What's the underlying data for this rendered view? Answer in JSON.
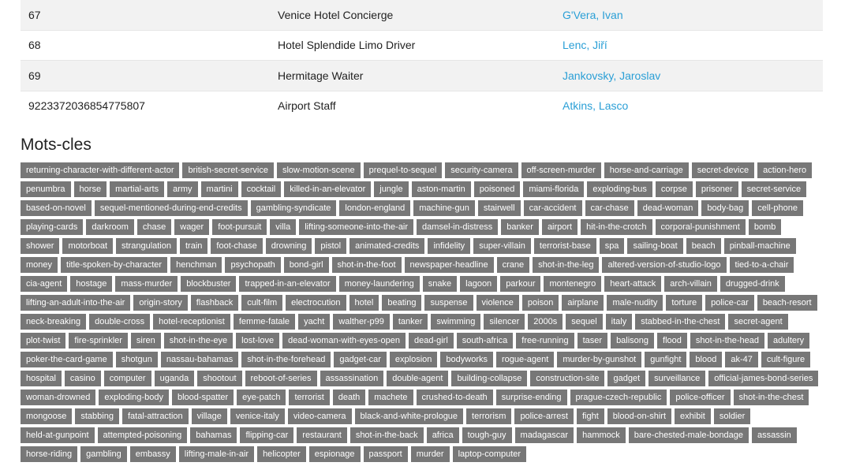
{
  "cast_rows": [
    {
      "id": "67",
      "role": "Venice Hotel Concierge",
      "actor": "G'Vera, Ivan"
    },
    {
      "id": "68",
      "role": "Hotel Splendide Limo Driver",
      "actor": "Lenc, Jiří"
    },
    {
      "id": "69",
      "role": "Hermitage Waiter",
      "actor": "Jankovsky, Jaroslav"
    },
    {
      "id": "9223372036854775807",
      "role": "Airport Staff",
      "actor": "Atkins, Lasco"
    }
  ],
  "keywords_section": {
    "title": "Mots-cles",
    "tags": [
      "returning-character-with-different-actor",
      "british-secret-service",
      "slow-motion-scene",
      "prequel-to-sequel",
      "security-camera",
      "off-screen-murder",
      "horse-and-carriage",
      "secret-device",
      "action-hero",
      "penumbra",
      "horse",
      "martial-arts",
      "army",
      "martini",
      "cocktail",
      "killed-in-an-elevator",
      "jungle",
      "aston-martin",
      "poisoned",
      "miami-florida",
      "exploding-bus",
      "corpse",
      "prisoner",
      "secret-service",
      "based-on-novel",
      "sequel-mentioned-during-end-credits",
      "gambling-syndicate",
      "london-england",
      "machine-gun",
      "stairwell",
      "car-accident",
      "car-chase",
      "dead-woman",
      "body-bag",
      "cell-phone",
      "playing-cards",
      "darkroom",
      "chase",
      "wager",
      "foot-pursuit",
      "villa",
      "lifting-someone-into-the-air",
      "damsel-in-distress",
      "banker",
      "airport",
      "hit-in-the-crotch",
      "corporal-punishment",
      "bomb",
      "shower",
      "motorboat",
      "strangulation",
      "train",
      "foot-chase",
      "drowning",
      "pistol",
      "animated-credits",
      "infidelity",
      "super-villain",
      "terrorist-base",
      "spa",
      "sailing-boat",
      "beach",
      "pinball-machine",
      "money",
      "title-spoken-by-character",
      "henchman",
      "psychopath",
      "bond-girl",
      "shot-in-the-foot",
      "newspaper-headline",
      "crane",
      "shot-in-the-leg",
      "altered-version-of-studio-logo",
      "tied-to-a-chair",
      "cia-agent",
      "hostage",
      "mass-murder",
      "blockbuster",
      "trapped-in-an-elevator",
      "money-laundering",
      "snake",
      "lagoon",
      "parkour",
      "montenegro",
      "heart-attack",
      "arch-villain",
      "drugged-drink",
      "lifting-an-adult-into-the-air",
      "origin-story",
      "flashback",
      "cult-film",
      "electrocution",
      "hotel",
      "beating",
      "suspense",
      "violence",
      "poison",
      "airplane",
      "male-nudity",
      "torture",
      "police-car",
      "beach-resort",
      "neck-breaking",
      "double-cross",
      "hotel-receptionist",
      "femme-fatale",
      "yacht",
      "walther-p99",
      "tanker",
      "swimming",
      "silencer",
      "2000s",
      "sequel",
      "italy",
      "stabbed-in-the-chest",
      "secret-agent",
      "plot-twist",
      "fire-sprinkler",
      "siren",
      "shot-in-the-eye",
      "lost-love",
      "dead-woman-with-eyes-open",
      "dead-girl",
      "south-africa",
      "free-running",
      "taser",
      "balisong",
      "flood",
      "shot-in-the-head",
      "adultery",
      "poker-the-card-game",
      "shotgun",
      "nassau-bahamas",
      "shot-in-the-forehead",
      "gadget-car",
      "explosion",
      "bodyworks",
      "rogue-agent",
      "murder-by-gunshot",
      "gunfight",
      "blood",
      "ak-47",
      "cult-figure",
      "hospital",
      "casino",
      "computer",
      "uganda",
      "shootout",
      "reboot-of-series",
      "assassination",
      "double-agent",
      "building-collapse",
      "construction-site",
      "gadget",
      "surveillance",
      "official-james-bond-series",
      "woman-drowned",
      "exploding-body",
      "blood-spatter",
      "eye-patch",
      "terrorist",
      "death",
      "machete",
      "crushed-to-death",
      "surprise-ending",
      "prague-czech-republic",
      "police-officer",
      "shot-in-the-chest",
      "mongoose",
      "stabbing",
      "fatal-attraction",
      "village",
      "venice-italy",
      "video-camera",
      "black-and-white-prologue",
      "terrorism",
      "police-arrest",
      "fight",
      "blood-on-shirt",
      "exhibit",
      "soldier",
      "held-at-gunpoint",
      "attempted-poisoning",
      "bahamas",
      "flipping-car",
      "restaurant",
      "shot-in-the-back",
      "africa",
      "tough-guy",
      "madagascar",
      "hammock",
      "bare-chested-male-bondage",
      "assassin",
      "horse-riding",
      "gambling",
      "embassy",
      "lifting-male-in-air",
      "helicopter",
      "espionage",
      "passport",
      "murder",
      "laptop-computer"
    ]
  },
  "colors": {
    "tag_background": "#777777",
    "link": "#2a9fd6",
    "row_stripe": "#f2f2f2"
  }
}
